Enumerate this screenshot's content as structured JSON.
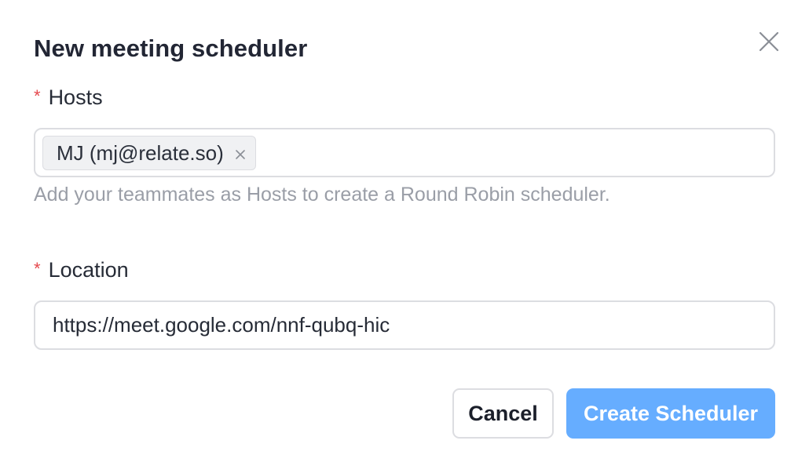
{
  "dialog": {
    "title": "New meeting scheduler",
    "close_icon": "close-icon"
  },
  "hosts": {
    "required_marker": "*",
    "label": "Hosts",
    "tags": [
      {
        "text": "MJ (mj@relate.so)",
        "remove_icon": "close-icon"
      }
    ],
    "hint": "Add your teammates as Hosts to create a Round Robin scheduler."
  },
  "location": {
    "required_marker": "*",
    "label": "Location",
    "value": "https://meet.google.com/nnf-qubq-hic"
  },
  "actions": {
    "cancel_label": "Cancel",
    "create_label": "Create Scheduler"
  },
  "colors": {
    "required": "#e5484d",
    "primary_button": "#66adff",
    "title_text": "#222634",
    "hint_text": "#9a9ea7",
    "border": "#dcdde1"
  }
}
